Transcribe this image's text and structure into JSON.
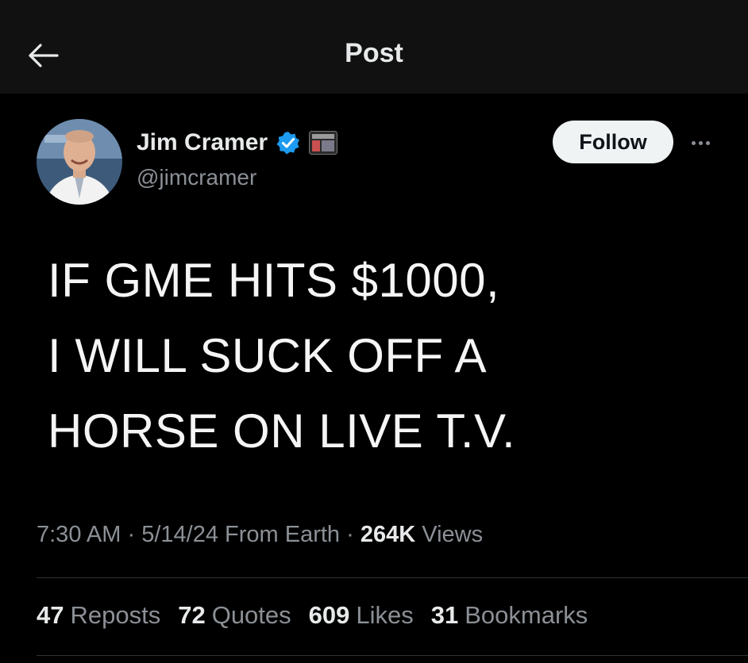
{
  "header": {
    "title": "Post",
    "back_icon": "arrow-left-icon"
  },
  "author": {
    "name": "Jim Cramer",
    "handle": "@jimcramer",
    "verified_icon": "verified-badge-icon",
    "affiliate_icon": "affiliate-badge-icon",
    "verified_color": "#1d9bf0"
  },
  "follow_label": "Follow",
  "more_icon": "more-dots-icon",
  "tweet": {
    "lines": [
      "IF GME HITS $1000,",
      "I WILL SUCK OFF A",
      "HORSE ON LIVE T.V."
    ]
  },
  "meta": {
    "time": "7:30 AM",
    "sep1": "·",
    "date": "5/14/24",
    "source": "From Earth",
    "sep2": "·",
    "views_count": "264K",
    "views_label": "Views"
  },
  "stats": [
    {
      "count": "47",
      "label": "Reposts"
    },
    {
      "count": "72",
      "label": "Quotes"
    },
    {
      "count": "609",
      "label": "Likes"
    },
    {
      "count": "31",
      "label": "Bookmarks"
    }
  ]
}
